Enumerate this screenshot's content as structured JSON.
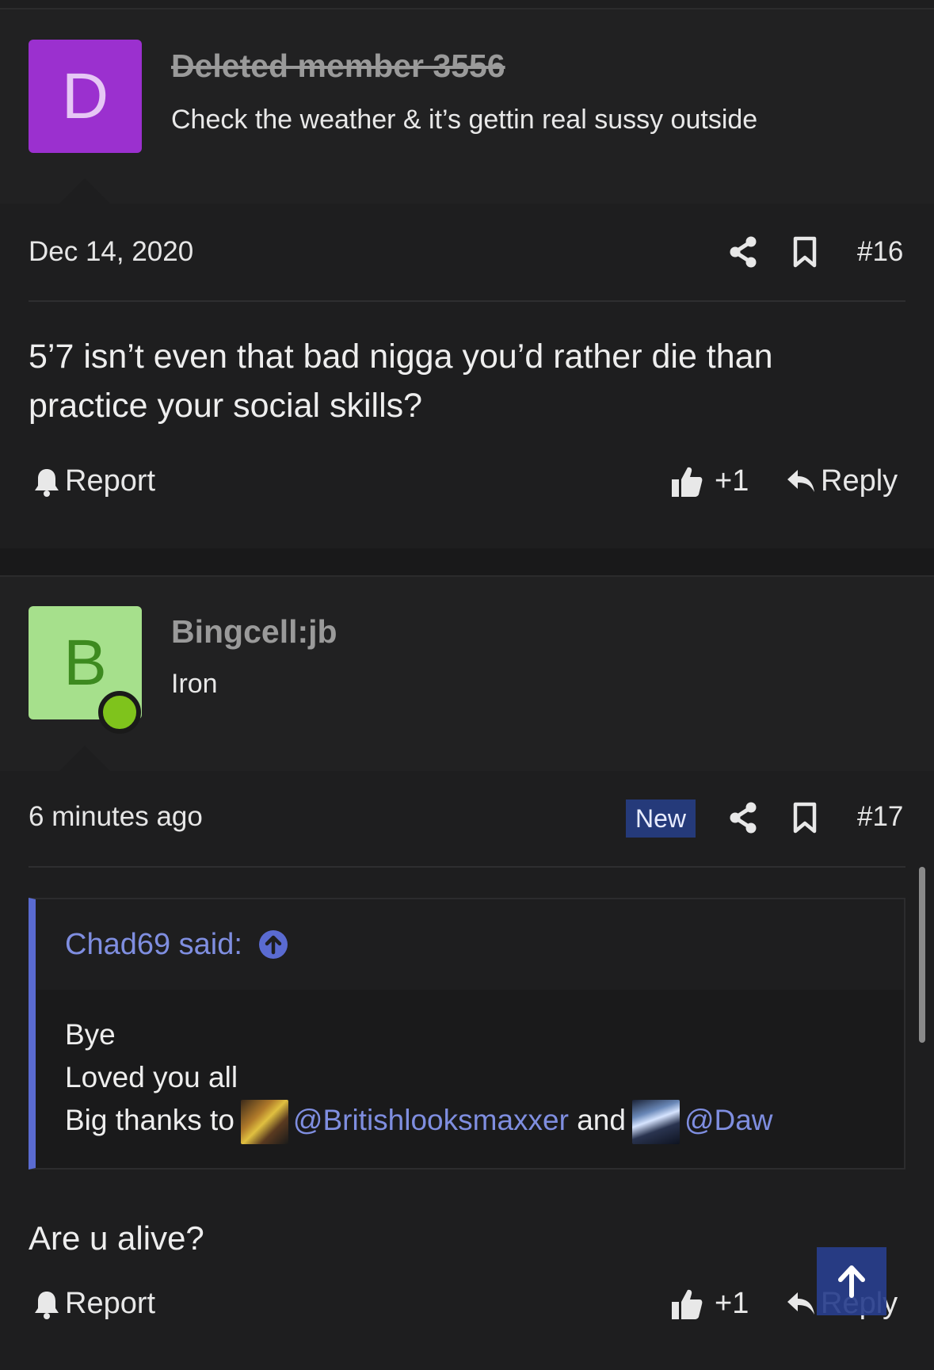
{
  "posts": [
    {
      "avatar_letter": "D",
      "username": "Deleted member 3556",
      "user_title": "Check the weather & it’s gettin real sussy outside",
      "date": "Dec 14, 2020",
      "post_number": "#16",
      "body": "5’7 isn’t even that bad nigga you’d rather die than practice your social skills?",
      "report_label": "Report",
      "like_count": "+1",
      "reply_label": "Reply"
    },
    {
      "avatar_letter": "B",
      "username": "Bingcell:jb",
      "user_title": "Iron",
      "date": "6 minutes ago",
      "new_badge": "New",
      "post_number": "#17",
      "quote": {
        "author": "Chad69 said:",
        "line1": "Bye",
        "line2": "Loved you all",
        "line3_prefix": "Big thanks to",
        "mention1": "@Britishlooksmaxxer",
        "line3_mid": "and",
        "mention2": "@Daw"
      },
      "body": "Are u alive?",
      "report_label": "Report",
      "like_count": "+1",
      "reply_label": "Reply"
    }
  ],
  "icons": {
    "share": "share-icon",
    "bookmark": "bookmark-icon",
    "bell": "bell-icon",
    "like": "thumbs-up-icon",
    "reply": "reply-icon",
    "quote_jump": "arrow-up-circle-icon",
    "back_to_top": "arrow-up-icon"
  },
  "colors": {
    "background": "#1e1e1f",
    "accent": "#7f8ee0",
    "badge": "#253a7a",
    "avatar_d": "#9b30cf",
    "avatar_b": "#a6e08c",
    "online": "#7fc31c"
  }
}
